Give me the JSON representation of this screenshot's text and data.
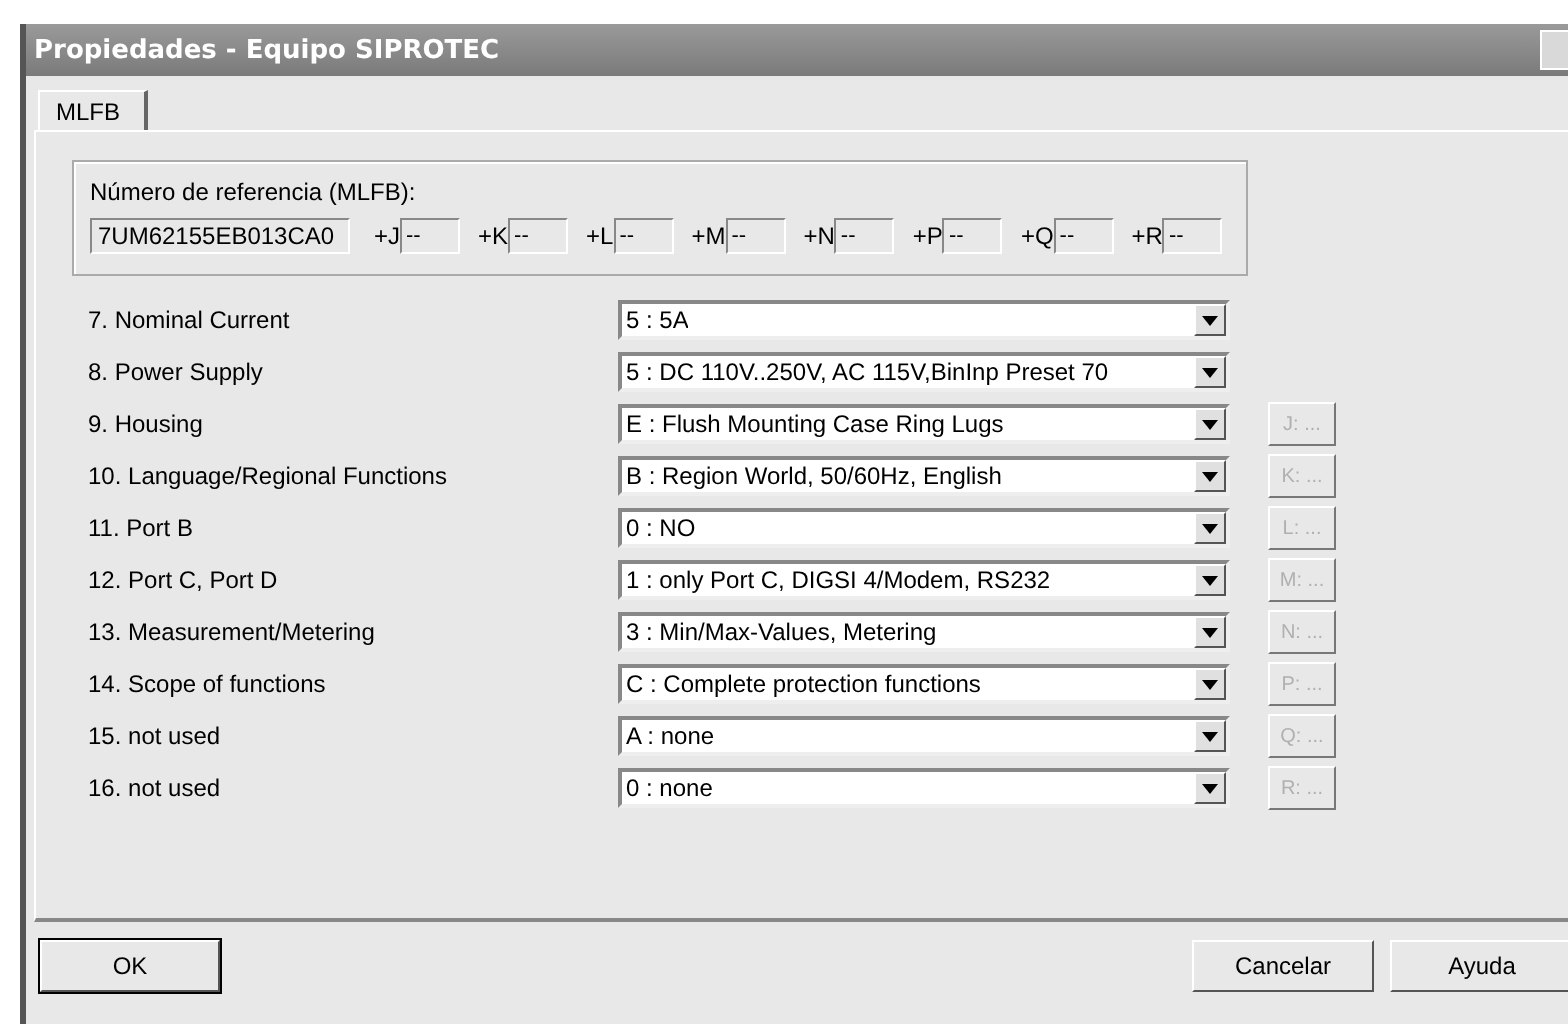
{
  "window": {
    "title": "Propiedades - Equipo SIPROTEC"
  },
  "tabs": [
    {
      "label": "MLFB",
      "selected": true
    }
  ],
  "reference": {
    "label": "Número de referencia (MLFB):",
    "value": "7UM62155EB013CA0",
    "extras": [
      {
        "label": "+J",
        "value": "--"
      },
      {
        "label": "+K",
        "value": "--"
      },
      {
        "label": "+L",
        "value": "--"
      },
      {
        "label": "+M",
        "value": "--"
      },
      {
        "label": "+N",
        "value": "--"
      },
      {
        "label": "+P",
        "value": "--"
      },
      {
        "label": "+Q",
        "value": "--"
      },
      {
        "label": "+R",
        "value": "--"
      }
    ]
  },
  "options": [
    {
      "label": "7. Nominal Current",
      "value": "5 : 5A"
    },
    {
      "label": "8. Power Supply",
      "value": "5 : DC 110V..250V, AC 115V,BinInp Preset 70"
    },
    {
      "label": "9. Housing",
      "value": "E : Flush Mounting Case Ring Lugs",
      "button": {
        "label": "J: ...",
        "disabled": true
      }
    },
    {
      "label": "10. Language/Regional Functions",
      "value": "B : Region World, 50/60Hz, English",
      "button": {
        "label": "K: ...",
        "disabled": true
      }
    },
    {
      "label": "11. Port B",
      "value": "0 : NO",
      "button": {
        "label": "L: ...",
        "disabled": true
      }
    },
    {
      "label": "12. Port C, Port D",
      "value": "1 : only Port C, DIGSI 4/Modem, RS232",
      "button": {
        "label": "M: ...",
        "disabled": true
      }
    },
    {
      "label": "13. Measurement/Metering",
      "value": "3 : Min/Max-Values, Metering",
      "button": {
        "label": "N: ...",
        "disabled": true
      }
    },
    {
      "label": "14. Scope of functions",
      "value": "C : Complete protection functions",
      "button": {
        "label": "P: ...",
        "disabled": true
      }
    },
    {
      "label": "15. not used",
      "value": "A : none",
      "button": {
        "label": "Q: ...",
        "disabled": true
      }
    },
    {
      "label": "16. not used",
      "value": "0 : none",
      "button": {
        "label": "R: ...",
        "disabled": true
      }
    }
  ],
  "buttons": [
    {
      "label": "OK",
      "default": true
    },
    {
      "label": "Cancelar",
      "default": false
    },
    {
      "label": "Ayuda",
      "default": false
    }
  ]
}
